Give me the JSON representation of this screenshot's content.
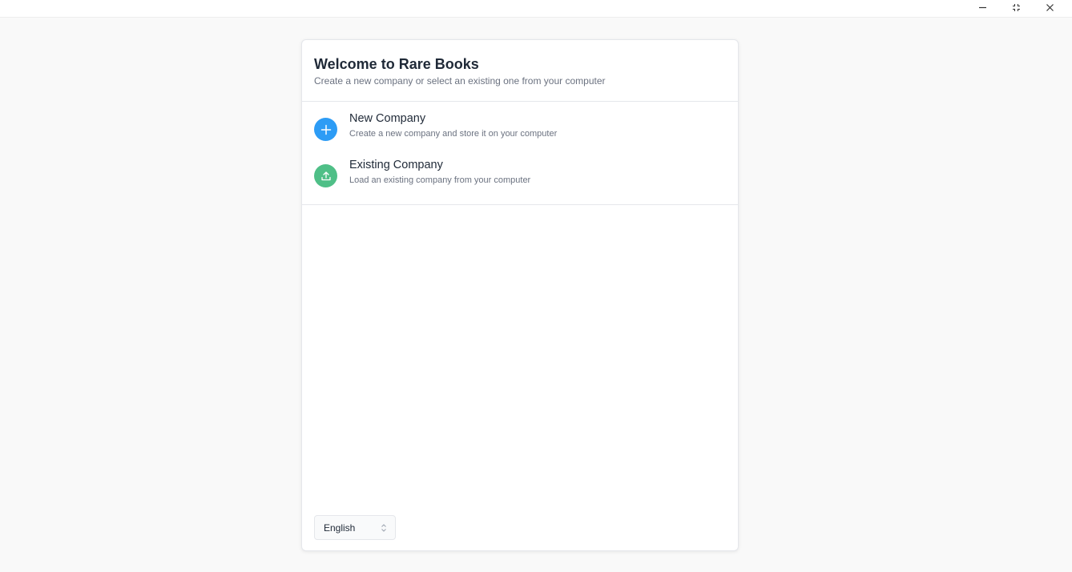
{
  "window": {
    "controls": {
      "minimize": "minimize-icon",
      "maximize": "maximize-icon",
      "close": "close-icon"
    }
  },
  "card": {
    "title": "Welcome to Rare Books",
    "subtitle": "Create a new company or select an existing one from your computer"
  },
  "options": [
    {
      "title": "New Company",
      "description": "Create a new company and store it on your computer",
      "icon": "plus-icon",
      "color": "#2d9cf5"
    },
    {
      "title": "Existing Company",
      "description": "Load an existing company from your computer",
      "icon": "upload-icon",
      "color": "#4fbf87"
    }
  ],
  "language": {
    "selected": "English"
  }
}
